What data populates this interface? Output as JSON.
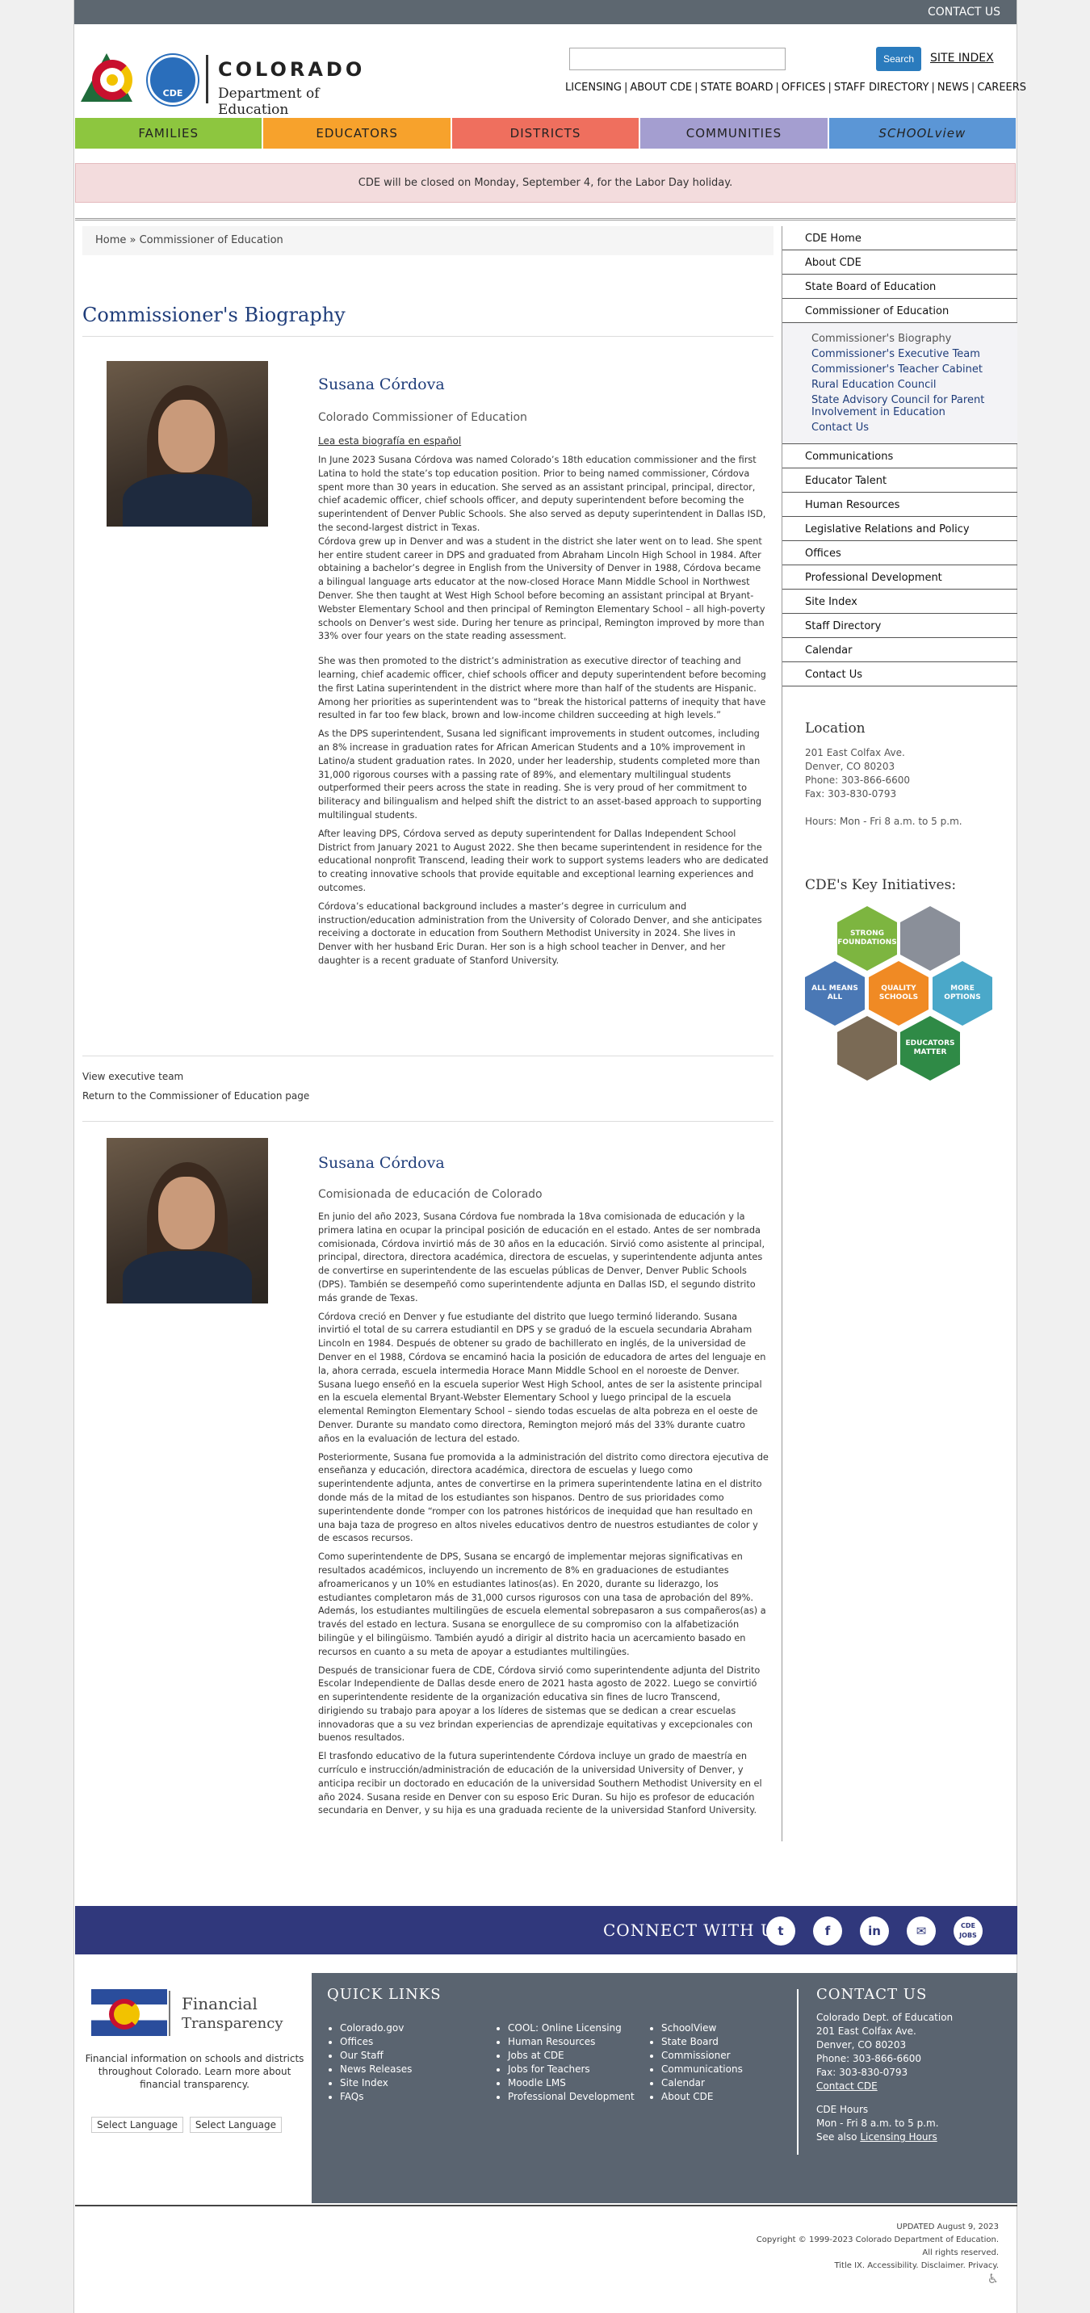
{
  "topbar": {
    "contact": "CONTACT US"
  },
  "logo": {
    "line1": "COLORADO",
    "line2": "Department of Education",
    "badge": "CDE"
  },
  "search": {
    "placeholder": "",
    "button": "Search",
    "site_index": "SITE INDEX"
  },
  "utility_nav": [
    "LICENSING",
    "ABOUT CDE",
    "STATE BOARD",
    "OFFICES",
    "STAFF DIRECTORY",
    "NEWS",
    "CAREERS"
  ],
  "main_nav": [
    {
      "label": "FAMILIES",
      "color": "#8dc63f"
    },
    {
      "label": "EDUCATORS",
      "color": "#f7a22c"
    },
    {
      "label": "DISTRICTS",
      "color": "#ef6f5e"
    },
    {
      "label": "COMMUNITIES",
      "color": "#a49ed0"
    },
    {
      "label": "SCHOOLview",
      "color": "#5b96d6"
    }
  ],
  "alert": "CDE will be closed on Monday, September 4, for the Labor Day holiday.",
  "breadcrumb": "Home » Commissioner of Education",
  "page_title": "Commissioner's Biography",
  "bio_en": {
    "name": "Susana Córdova",
    "role": "Colorado Commissioner of Education",
    "spanish_link": "Lea esta biografía en español",
    "paragraphs": [
      "In June 2023 Susana Córdova was named Colorado’s 18th education commissioner and the first Latina to hold the state’s top education position. Prior to being named commissioner, Córdova spent more than 30 years in education. She served as an assistant principal, principal, director, chief academic officer, chief schools officer, and deputy superintendent before becoming the superintendent of Denver Public Schools. She also served as deputy superintendent in Dallas ISD, the second-largest district in Texas.",
      "Córdova grew up in Denver and was a student in the district she later went on to lead. She spent her entire student career in DPS and graduated from Abraham Lincoln High School in 1984. After obtaining a bachelor’s degree in English from the University of Denver in 1988, Córdova became a bilingual language arts educator at the now-closed Horace Mann Middle School in Northwest Denver. She then taught at West High School before becoming an assistant principal at Bryant-Webster Elementary School and then principal of Remington Elementary School – all high-poverty schools on Denver’s west side. During her tenure as principal, Remington improved by more than 33% over four years on the state reading assessment.",
      "She was then promoted to the district’s administration as executive director of teaching and learning, chief academic officer, chief schools officer and deputy superintendent before becoming the first Latina superintendent in the district where more than half of the students are Hispanic.",
      "As the DPS superintendent, Susana led significant improvements in student outcomes, including an 8% increase in graduation rates for African American Students and a 10% improvement in Latino/a student graduation rates. In 2020, under her leadership, students completed more than 31,000 rigorous courses with a passing rate of 89%, and elementary multilingual students outperformed their peers across the state in reading. She is very proud of her commitment to biliteracy and bilingualism and helped shift the district to an asset-based approach to supporting multilingual students.",
      "After leaving DPS, Córdova served as deputy superintendent for Dallas Independent School District from January 2021 to August 2022. She then became superintendent in residence for the educational nonprofit Transcend, leading their work to support systems leaders who are dedicated to creating innovative schools that provide equitable and exceptional learning experiences and outcomes.",
      "Córdova’s educational background includes a master’s degree in curriculum and instruction/education administration from the University of Colorado Denver, and she anticipates receiving a doctorate in education from Southern Methodist University in 2024. She lives in Denver with her husband Eric Duran. Her son is a high school teacher in Denver, and her daughter is a recent graduate of Stanford University."
    ],
    "quote_link": "Among her priorities as superintendent was to “break the historical patterns of inequity that have resulted in far too few black, brown and low-income children succeeding at high levels.”"
  },
  "links": {
    "exec_team": "View executive team",
    "return": "Return to the Commissioner of Education page"
  },
  "bio_es": {
    "name": "Susana Córdova",
    "role": "Comisionada de educación de Colorado",
    "paragraphs": [
      "En junio del año 2023, Susana Córdova fue nombrada la 18va comisionada de educación y la primera latina en ocupar la principal posición de educación en el estado. Antes de ser nombrada comisionada, Córdova invirtió más de 30 años en la educación. Sirvió como asistente al principal, principal, directora, directora académica, directora de escuelas, y superintendente adjunta antes de convertirse en superintendente de las escuelas públicas de Denver, Denver Public Schools (DPS). También se desempeñó como superintendente adjunta en Dallas ISD, el segundo distrito más grande de Texas.",
      "Córdova creció en Denver y fue estudiante del distrito que luego terminó liderando. Susana invirtió el total de su carrera estudiantil en DPS y se graduó de la escuela secundaria Abraham Lincoln en 1984. Después de obtener su grado de  bachillerato en inglés, de la universidad de Denver en el 1988, Córdova se encaminó hacia la posición de educadora de artes del lenguaje en la, ahora cerrada, escuela intermedia Horace Mann Middle School en el noroeste de Denver. Susana luego enseñó en la escuela superior West High School, antes de ser la asistente principal en la escuela elemental Bryant-Webster Elementary School y luego principal de la escuela elemental Remington Elementary School – siendo todas escuelas de alta pobreza en el oeste de Denver. Durante su mandato como directora, Remington mejoró más del 33% durante cuatro años en la evaluación de lectura del estado.",
      "Posteriormente, Susana fue promovida a la administración del distrito como directora ejecutiva de enseñanza y educación, directora académica, directora de escuelas y luego como superintendente adjunta, antes de convertirse en la primera superintendente latina en el distrito donde más de la mitad de los estudiantes son hispanos. Dentro de sus prioridades como superintendente donde “romper con los patrones históricos de inequidad que han resultado en una baja taza de progreso en altos niveles educativos dentro de nuestros estudiantes de color y de escasos recursos.",
      "Como superintendente de DPS, Susana se encargó de implementar mejoras significativas en resultados académicos, incluyendo un incremento de 8% en graduaciones de estudiantes afroamericanos y un 10% en estudiantes latinos(as). En 2020, durante su liderazgo, los estudiantes completaron más de 31,000 cursos rigurosos con una tasa de aprobación del 89%. Además, los estudiantes multilingües de escuela elemental sobrepasaron a sus compañeros(as) a través del estado en lectura. Susana se enorgullece de su compromiso con la alfabetización bilingüe y el bilingüismo. También ayudó a dirigir al distrito hacia un acercamiento basado en recursos en cuanto a su meta de apoyar a estudiantes multilingües.",
      "Después de transicionar fuera de CDE, Córdova sirvió como superintendente adjunta del Distrito Escolar Independiente de Dallas desde enero de 2021 hasta agosto de 2022. Luego se convirtió en superintendente residente de la organización educativa sin fines de lucro Transcend, dirigiendo su trabajo para apoyar a los líderes de sistemas que se dedican a crear escuelas innovadoras que a su vez brindan experiencias de aprendizaje equitativas y excepcionales con buenos resultados.",
      "El trasfondo educativo de la futura superintendente Córdova incluye un grado de maestría en currículo e instrucción/administración de educación de la universidad University of Denver, y anticipa recibir un doctorado en educación de la universidad Southern Methodist University en el año 2024. Susana reside en Denver con su esposo Eric Duran. Su hijo es profesor de educación secundaria en Denver, y su hija es una graduada reciente de la universidad Stanford University."
    ]
  },
  "sidebar": {
    "items_top": [
      "CDE Home",
      "About CDE",
      "State Board of Education",
      "Commissioner of Education"
    ],
    "sub_items": [
      "Commissioner's Biography",
      "Commissioner's Executive Team",
      "Commissioner's Teacher Cabinet",
      "Rural Education Council",
      "State Advisory Council for Parent Involvement in Education",
      "Contact Us"
    ],
    "items_bottom": [
      "Communications",
      "Educator Talent",
      "Human Resources",
      "Legislative Relations and Policy",
      "Offices",
      "Professional Development",
      "Site Index",
      "Staff Directory",
      "Calendar",
      "Contact Us"
    ]
  },
  "location": {
    "heading": "Location",
    "address1": "201 East Colfax Ave.",
    "address2": "Denver, CO 80203",
    "phone": "Phone: 303-866-6600",
    "fax": "Fax: 303-830-0793",
    "hours": "Hours: Mon - Fri 8 a.m. to 5 p.m."
  },
  "initiatives": {
    "heading": "CDE's Key Initiatives:",
    "items": [
      "STRONG FOUNDATIONS",
      "ALL MEANS ALL",
      "QUALITY SCHOOLS",
      "MORE OPTIONS",
      "EDUCATORS MATTER"
    ]
  },
  "connect": {
    "label": "CONNECT WITH US",
    "icons": [
      "twitter-icon",
      "facebook-icon",
      "linkedin-icon",
      "email-icon",
      "cde-jobs-icon"
    ],
    "jobs_label": "CDE JOBS"
  },
  "financial": {
    "title1": "Financial",
    "title2": "Transparency",
    "text": "Financial information on schools and districts throughout Colorado.",
    "learn": "Learn more about financial transparency.",
    "translate": [
      "Select Language",
      "Select Language"
    ]
  },
  "quick_links": {
    "heading": "QUICK LINKS",
    "col1": [
      "Colorado.gov",
      "Offices",
      "Our Staff",
      "News Releases",
      "Site Index",
      "FAQs"
    ],
    "col2": [
      "COOL: Online Licensing",
      "Human Resources",
      "Jobs at CDE",
      "Jobs for Teachers",
      "Moodle LMS",
      "Professional Development"
    ],
    "col3": [
      "SchoolView",
      "State Board",
      "Commissioner",
      "Communications",
      "Calendar",
      "About CDE"
    ]
  },
  "contact_us": {
    "heading": "CONTACT US",
    "lines": [
      "Colorado Dept. of Education",
      "201 East Colfax Ave.",
      "Denver, CO 80203",
      "Phone: 303-866-6600",
      "Fax: 303-830-0793"
    ],
    "link": "Contact CDE",
    "hours_label": "CDE Hours",
    "hours": "Mon - Fri 8 a.m. to 5 p.m.",
    "see_also": "See also",
    "licensing_hours": "Licensing Hours"
  },
  "copyright": {
    "updated": "UPDATED August 9, 2023",
    "copy": "Copyright © 1999-2023 Colorado Department of Education.",
    "rights": "All rights reserved.",
    "links": [
      "Title IX",
      "Accessibility",
      "Disclaimer",
      "Privacy"
    ]
  }
}
